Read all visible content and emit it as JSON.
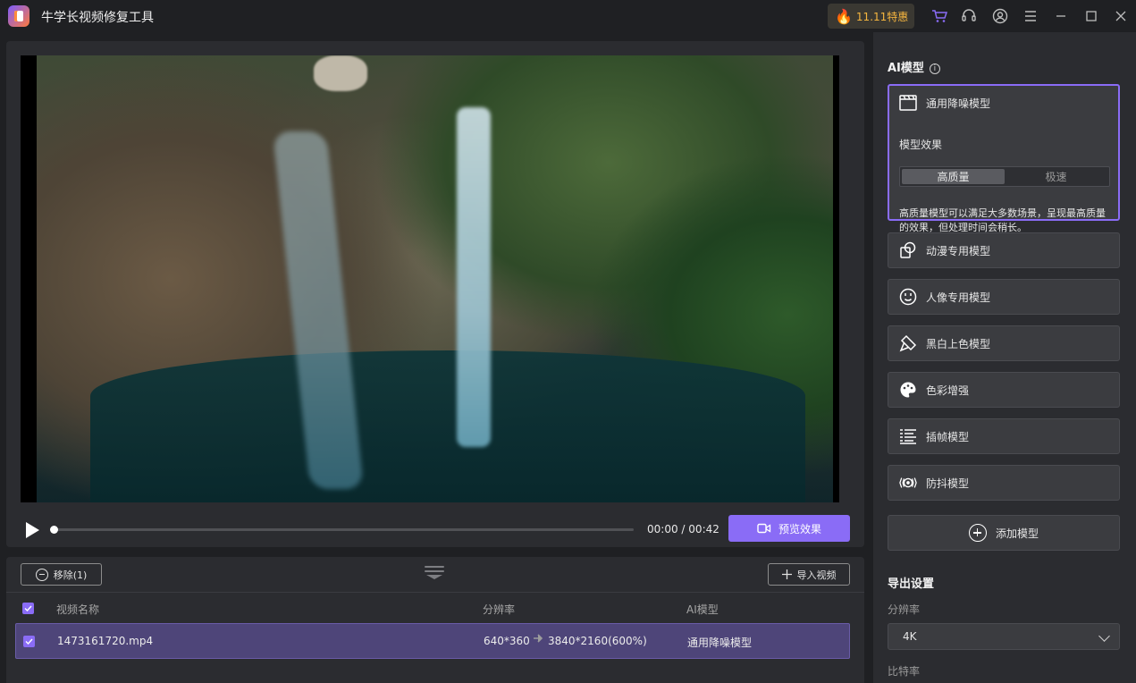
{
  "app": {
    "title": "牛学长视频修复工具",
    "promo_label": "11.11特惠",
    "accent_color": "#8a6cf6"
  },
  "titlebar_icons": [
    "cart-icon",
    "headset-icon",
    "user-icon",
    "menu-icon",
    "minimize-icon",
    "maximize-icon",
    "close-icon"
  ],
  "player": {
    "current_time": "00:00",
    "time_separator": "/",
    "total_time": "00:42",
    "progress": 0.0,
    "preview_label": "预览效果"
  },
  "file_list": {
    "remove_label": "移除(1)",
    "import_label": "导入视频",
    "columns": {
      "name": "视频名称",
      "resolution": "分辨率",
      "model": "AI模型"
    },
    "rows": [
      {
        "checked": true,
        "name": "1473161720.mp4",
        "resolution_from": "640*360",
        "resolution_to": "3840*2160(600%)",
        "model": "通用降噪模型"
      }
    ]
  },
  "ai_models": {
    "title": "AI模型",
    "active": {
      "name": "通用降噪模型",
      "effect_label": "模型效果",
      "options": [
        "高质量",
        "极速"
      ],
      "selected_option": "高质量",
      "description": "高质量模型可以满足大多数场景，呈现最高质量的效果，但处理时间会稍长。"
    },
    "others": [
      {
        "name": "动漫专用模型",
        "icon": "anime-icon"
      },
      {
        "name": "人像专用模型",
        "icon": "portrait-icon"
      },
      {
        "name": "黑白上色模型",
        "icon": "colorize-icon"
      },
      {
        "name": "色彩增强",
        "icon": "palette-icon"
      },
      {
        "name": "插帧模型",
        "icon": "frame-interp-icon"
      },
      {
        "name": "防抖模型",
        "icon": "stabilize-icon"
      }
    ],
    "add_label": "添加模型"
  },
  "export": {
    "title": "导出设置",
    "resolution_label": "分辨率",
    "resolution_value": "4K",
    "bitrate_label": "比特率"
  }
}
